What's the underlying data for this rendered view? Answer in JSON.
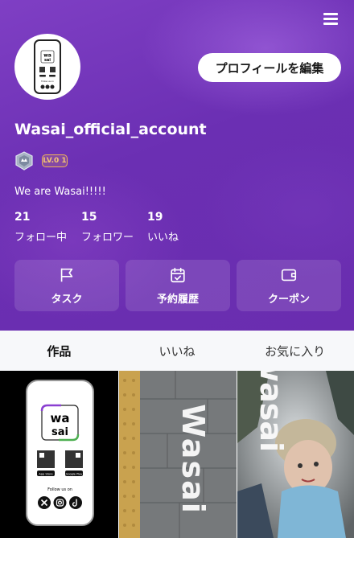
{
  "profile": {
    "username": "Wasai_official_account",
    "level": "LV.0 1",
    "bio": "We are Wasai!!!!!",
    "edit_button": "プロフィールを編集"
  },
  "stats": [
    {
      "count": "21",
      "label": "フォロー中"
    },
    {
      "count": "15",
      "label": "フォロワー"
    },
    {
      "count": "19",
      "label": "いいね"
    }
  ],
  "actions": [
    {
      "label": "タスク",
      "icon": "flag-icon"
    },
    {
      "label": "予約履歴",
      "icon": "calendar-check-icon"
    },
    {
      "label": "クーポン",
      "icon": "wallet-icon"
    }
  ],
  "tabs": [
    {
      "label": "作品",
      "active": true
    },
    {
      "label": "いいね",
      "active": false
    },
    {
      "label": "お気に入り",
      "active": false
    }
  ],
  "avatar": {
    "logo_line1": "wa",
    "logo_line2": "sai",
    "caption": "Follow us on"
  },
  "posts": [
    {
      "logo_line1": "wa",
      "logo_line2": "sai",
      "caption": "Follow us on",
      "store1": "App Store",
      "store2": "Google Play"
    },
    {
      "word": "Wasai"
    },
    {
      "word": "wasai"
    }
  ],
  "colors": {
    "header": "#6b2fb3",
    "badge": "#f0b35a"
  }
}
